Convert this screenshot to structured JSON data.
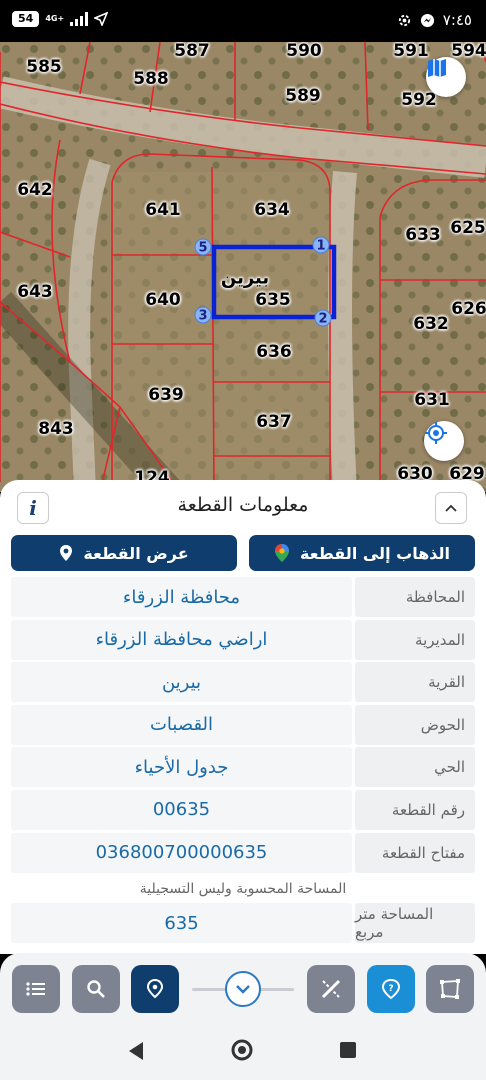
{
  "status_bar": {
    "battery": "54",
    "network": "4G+",
    "time": "٧:٤٥"
  },
  "map": {
    "parcel_numbers": [
      "585",
      "587",
      "588",
      "590",
      "591",
      "594",
      "589",
      "592",
      "642",
      "641",
      "634",
      "633",
      "625",
      "643",
      "640",
      "635",
      "632",
      "626",
      "639",
      "636",
      "631",
      "843",
      "637",
      "630",
      "629",
      "124"
    ],
    "village_label": "بيرين",
    "corner_points": [
      "1",
      "2",
      "3",
      "5"
    ],
    "layers_icon": "map-layers-icon",
    "locate_icon": "gps-locate-icon",
    "parcel_line_color": "#e0262b",
    "selected_outline_color": "#0a22d6"
  },
  "sheet": {
    "title": "معلومات القطعة",
    "info_icon": "i",
    "go_to_parcel": "الذهاب إلى القطعة",
    "show_parcel": "عرض القطعة",
    "rows": [
      {
        "label": "المحافظة",
        "value": "محافظة الزرقاء"
      },
      {
        "label": "المديرية",
        "value": "اراضي محافظة الزرقاء"
      },
      {
        "label": "القرية",
        "value": "بيرين"
      },
      {
        "label": "الحوض",
        "value": "القصبات"
      },
      {
        "label": "الحي",
        "value": "جدول الأحياء"
      },
      {
        "label": "رقم القطعة",
        "value": "00635"
      },
      {
        "label": "مفتاح القطعة",
        "value": "036800700000635"
      }
    ],
    "note": "المساحة المحسوبة وليس التسجيلية",
    "area_label": "المساحة متر مربع",
    "area_value": "635"
  },
  "toolbar": {
    "icons": [
      "list-icon",
      "search-icon",
      "location-pin-icon",
      "chevron-down-icon",
      "measure-tools-icon",
      "help-icon",
      "polygon-icon"
    ]
  },
  "colors": {
    "navy": "#0f3e6e",
    "accent_blue": "#1a8fd6",
    "value_blue": "#1a6aa8"
  }
}
